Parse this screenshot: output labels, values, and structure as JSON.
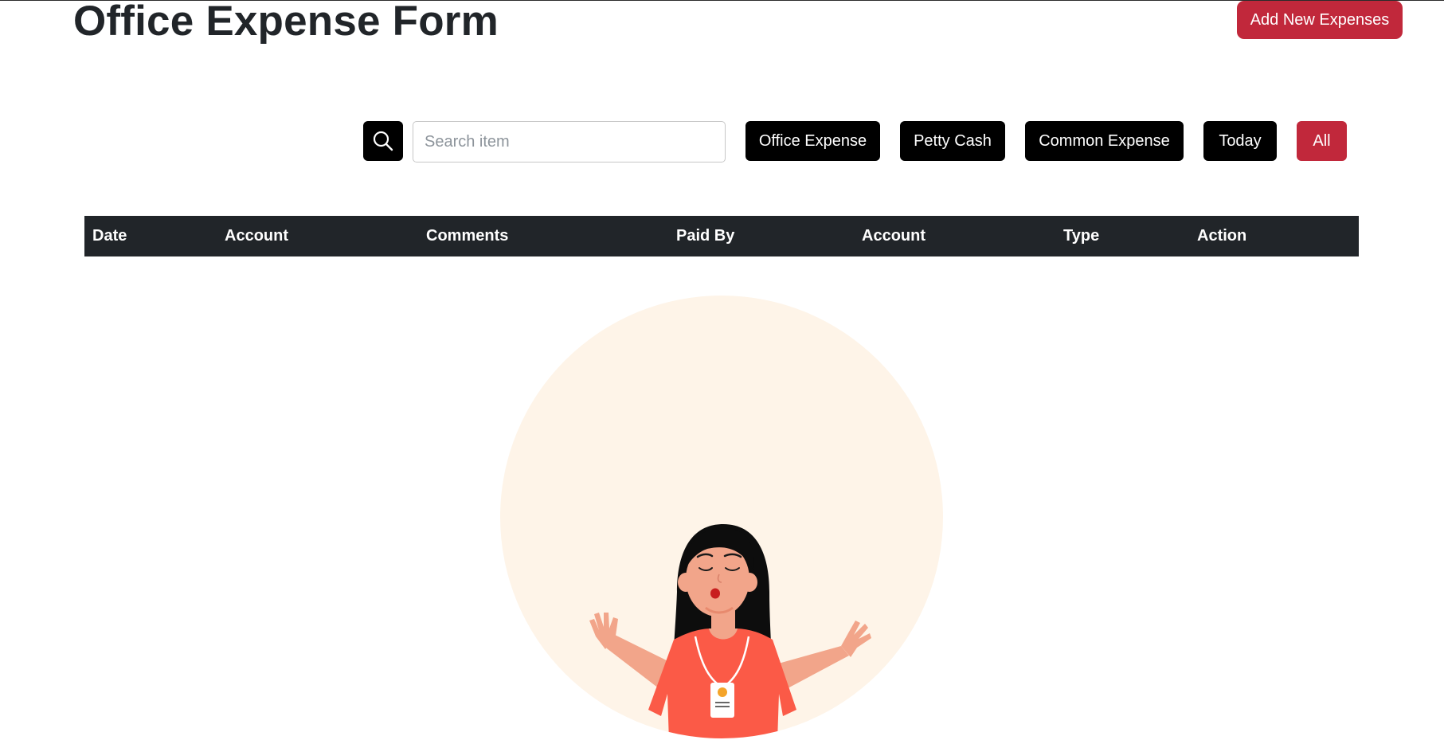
{
  "header": {
    "title": "Office Expense Form",
    "add_button_label": "Add New Expenses"
  },
  "search": {
    "icon": "search-icon",
    "placeholder": "Search item",
    "value": ""
  },
  "filters": [
    {
      "label": "Office Expense",
      "active": false
    },
    {
      "label": "Petty Cash",
      "active": false
    },
    {
      "label": "Common Expense",
      "active": false
    },
    {
      "label": "Today",
      "active": false
    },
    {
      "label": "All",
      "active": true
    }
  ],
  "table": {
    "columns": [
      "Date",
      "Account",
      "Comments",
      "Paid By",
      "Account",
      "Type",
      "Action"
    ],
    "rows": []
  },
  "empty_state": {
    "illustration": "woman-shrugging-illustration"
  },
  "colors": {
    "accent": "#c1283b",
    "dark": "#000000",
    "header_bg": "#212529",
    "illustration_bg": "#fef4e8"
  }
}
